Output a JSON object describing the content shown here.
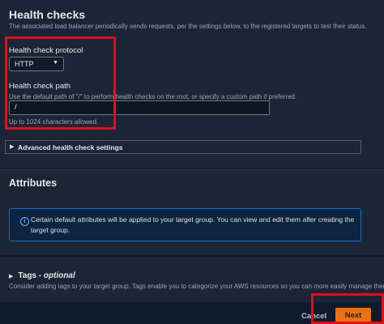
{
  "health_checks": {
    "title": "Health checks",
    "description": "The associated load balancer periodically sends requests, per the settings below, to the registered targets to test their status.",
    "protocol_label": "Health check protocol",
    "protocol_value": "HTTP",
    "path_label": "Health check path",
    "path_hint": "Use the default path of \"/\" to perform health checks on the root, or specify a custom path if preferred.",
    "path_value": "/",
    "path_constraint": "Up to 1024 characters allowed.",
    "advanced_label": "Advanced health check settings"
  },
  "attributes": {
    "title": "Attributes",
    "info_text": "Certain default attributes will be applied to your target group. You can view and edit them after creating the target group."
  },
  "tags": {
    "title": "Tags",
    "optional": "optional",
    "separator": " - ",
    "description": "Consider adding tags to your target group. Tags enable you to categorize your AWS resources so you can more easily manage them."
  },
  "footer": {
    "cancel_label": "Cancel",
    "next_label": "Next"
  },
  "colors": {
    "highlight": "#e40d1b",
    "primary_button": "#ec7211",
    "info_border": "#0972d3"
  },
  "icons": {
    "dropdown": "caret-down-icon",
    "expand": "caret-right-icon",
    "info": "info-icon"
  }
}
